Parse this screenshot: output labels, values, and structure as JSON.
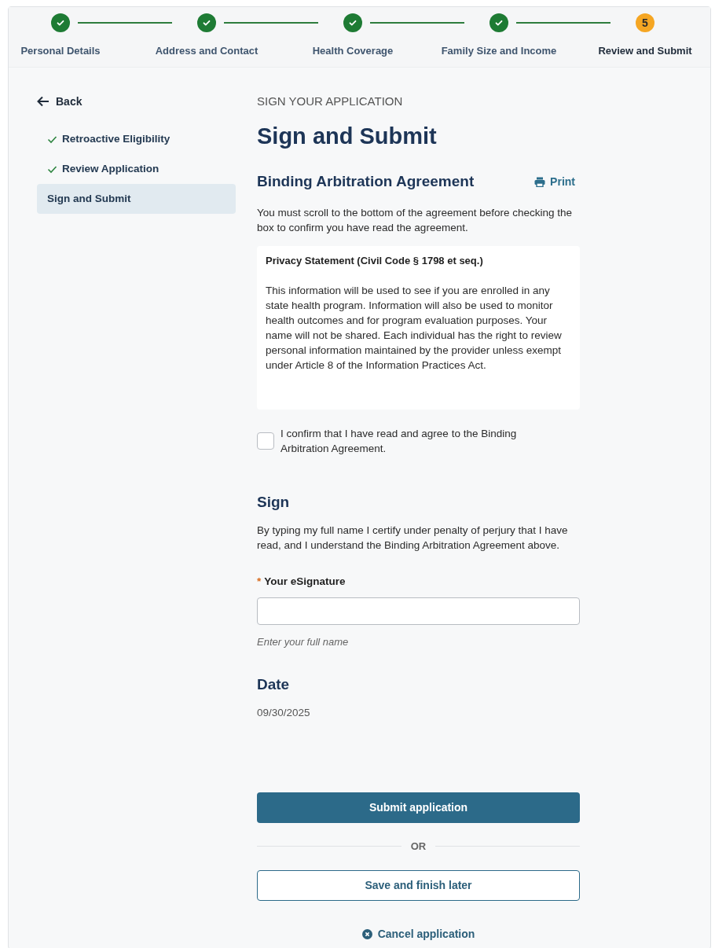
{
  "stepper": [
    {
      "label": "Personal Details",
      "kind": "complete"
    },
    {
      "label": "Address and Contact",
      "kind": "complete"
    },
    {
      "label": "Health Coverage",
      "kind": "complete"
    },
    {
      "label": "Family Size and Income",
      "kind": "complete"
    },
    {
      "label": "Review and Submit",
      "kind": "current",
      "number": "5"
    }
  ],
  "sidebar": {
    "back": "Back",
    "items": [
      {
        "label": "Retroactive Eligibility",
        "done": true,
        "selected": false
      },
      {
        "label": "Review Application",
        "done": true,
        "selected": false
      },
      {
        "label": "Sign and Submit",
        "done": false,
        "selected": true
      }
    ]
  },
  "main": {
    "overline": "SIGN YOUR APPLICATION",
    "title": "Sign and Submit",
    "agreement": {
      "heading": "Binding Arbitration Agreement",
      "print": "Print",
      "instructions": "You must scroll to the bottom of the agreement before checking the box to confirm you have read the agreement.",
      "document": {
        "title": "Privacy Statement (Civil Code § 1798 et seq.)",
        "body": "This information will be used to see if you are enrolled in any state health program. Information will also be used to monitor health outcomes and for program evaluation purposes. Your name will not be shared. Each individual has the right to review personal information maintained by the provider unless exempt under Article 8 of the Information Practices Act."
      },
      "confirm": {
        "label": "I confirm that I have read and agree to the Binding Arbitration Agreement.",
        "checked": false
      }
    },
    "sign": {
      "heading": "Sign",
      "text": "By typing my full name I certify under penalty of perjury that I have read, and I understand the Binding Arbitration Agreement above.",
      "required_mark": "*",
      "field_label": "Your eSignature",
      "hint": "Enter your full name"
    },
    "date": {
      "heading": "Date",
      "value": "09/30/2025"
    },
    "actions": {
      "submit": "Submit application",
      "or": "OR",
      "save": "Save and finish later",
      "cancel": "Cancel application"
    }
  }
}
